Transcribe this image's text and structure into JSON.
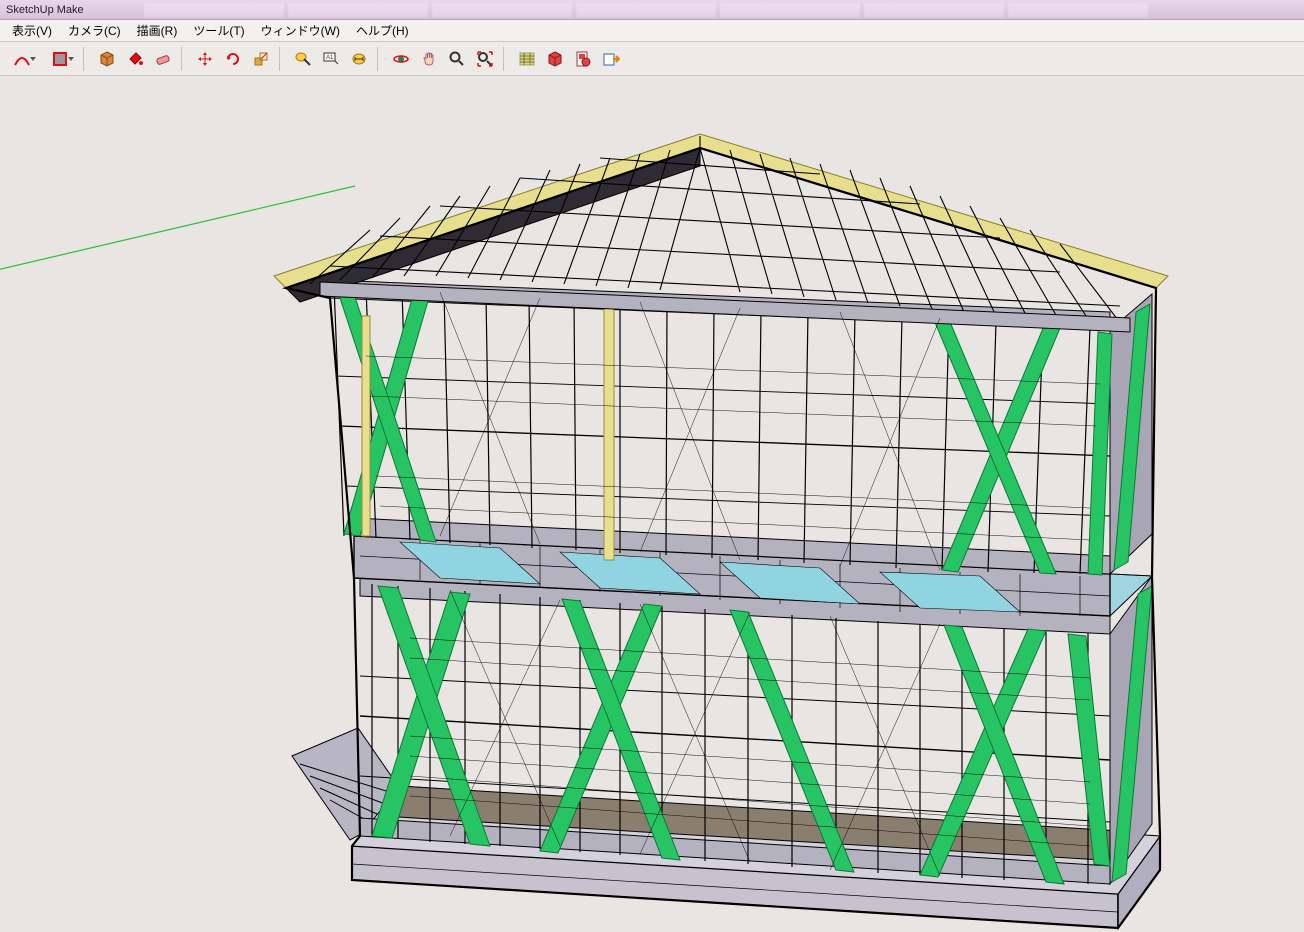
{
  "app": {
    "title": "SketchUp Make"
  },
  "menu": {
    "items": [
      "表示(V)",
      "カメラ(C)",
      "描画(R)",
      "ツール(T)",
      "ウィンドウ(W)",
      "ヘルプ(H)"
    ]
  },
  "toolbar": {
    "groups": [
      [
        {
          "name": "arc-tool-icon",
          "hint": "Arc",
          "dd": true
        },
        {
          "name": "shape-tool-icon",
          "hint": "Shape",
          "dd": true
        }
      ],
      [
        {
          "name": "make-component-icon",
          "hint": "Make Component"
        },
        {
          "name": "paint-bucket-icon",
          "hint": "Paint Bucket"
        },
        {
          "name": "eraser-icon",
          "hint": "Eraser"
        }
      ],
      [
        {
          "name": "move-icon",
          "hint": "Move"
        },
        {
          "name": "rotate-icon",
          "hint": "Rotate"
        },
        {
          "name": "scale-icon",
          "hint": "Scale"
        }
      ],
      [
        {
          "name": "tape-measure-icon",
          "hint": "Tape Measure"
        },
        {
          "name": "text-icon",
          "hint": "Text"
        },
        {
          "name": "dimension-icon",
          "hint": "Dimension"
        }
      ],
      [
        {
          "name": "orbit-icon",
          "hint": "Orbit"
        },
        {
          "name": "pan-icon",
          "hint": "Pan"
        },
        {
          "name": "zoom-icon",
          "hint": "Zoom"
        },
        {
          "name": "zoom-extents-icon",
          "hint": "Zoom Extents"
        }
      ],
      [
        {
          "name": "warehouse-icon",
          "hint": "3D Warehouse"
        },
        {
          "name": "extensions-icon",
          "hint": "Extension Warehouse"
        },
        {
          "name": "layout-icon",
          "hint": "LayOut"
        },
        {
          "name": "export-icon",
          "hint": "Export"
        }
      ]
    ]
  },
  "model": {
    "description": "Two-story timber-frame house skeleton on a foundation slab. Green diagonal braces, light-blue floor joist bays, hip-roof rafters with yellow fascia edges. Model axis visible as a green line going up-left.",
    "colors": {
      "bg": "#e9e5e3",
      "wood": "#b5b2c0",
      "brace": "#27c463",
      "floor": "#8fd4e0",
      "fascia": "#e8df8e",
      "axis": "#2bbf3a",
      "line": "#000000",
      "foundation": "#c6c3cf",
      "ground": "#8a7f6e"
    }
  }
}
